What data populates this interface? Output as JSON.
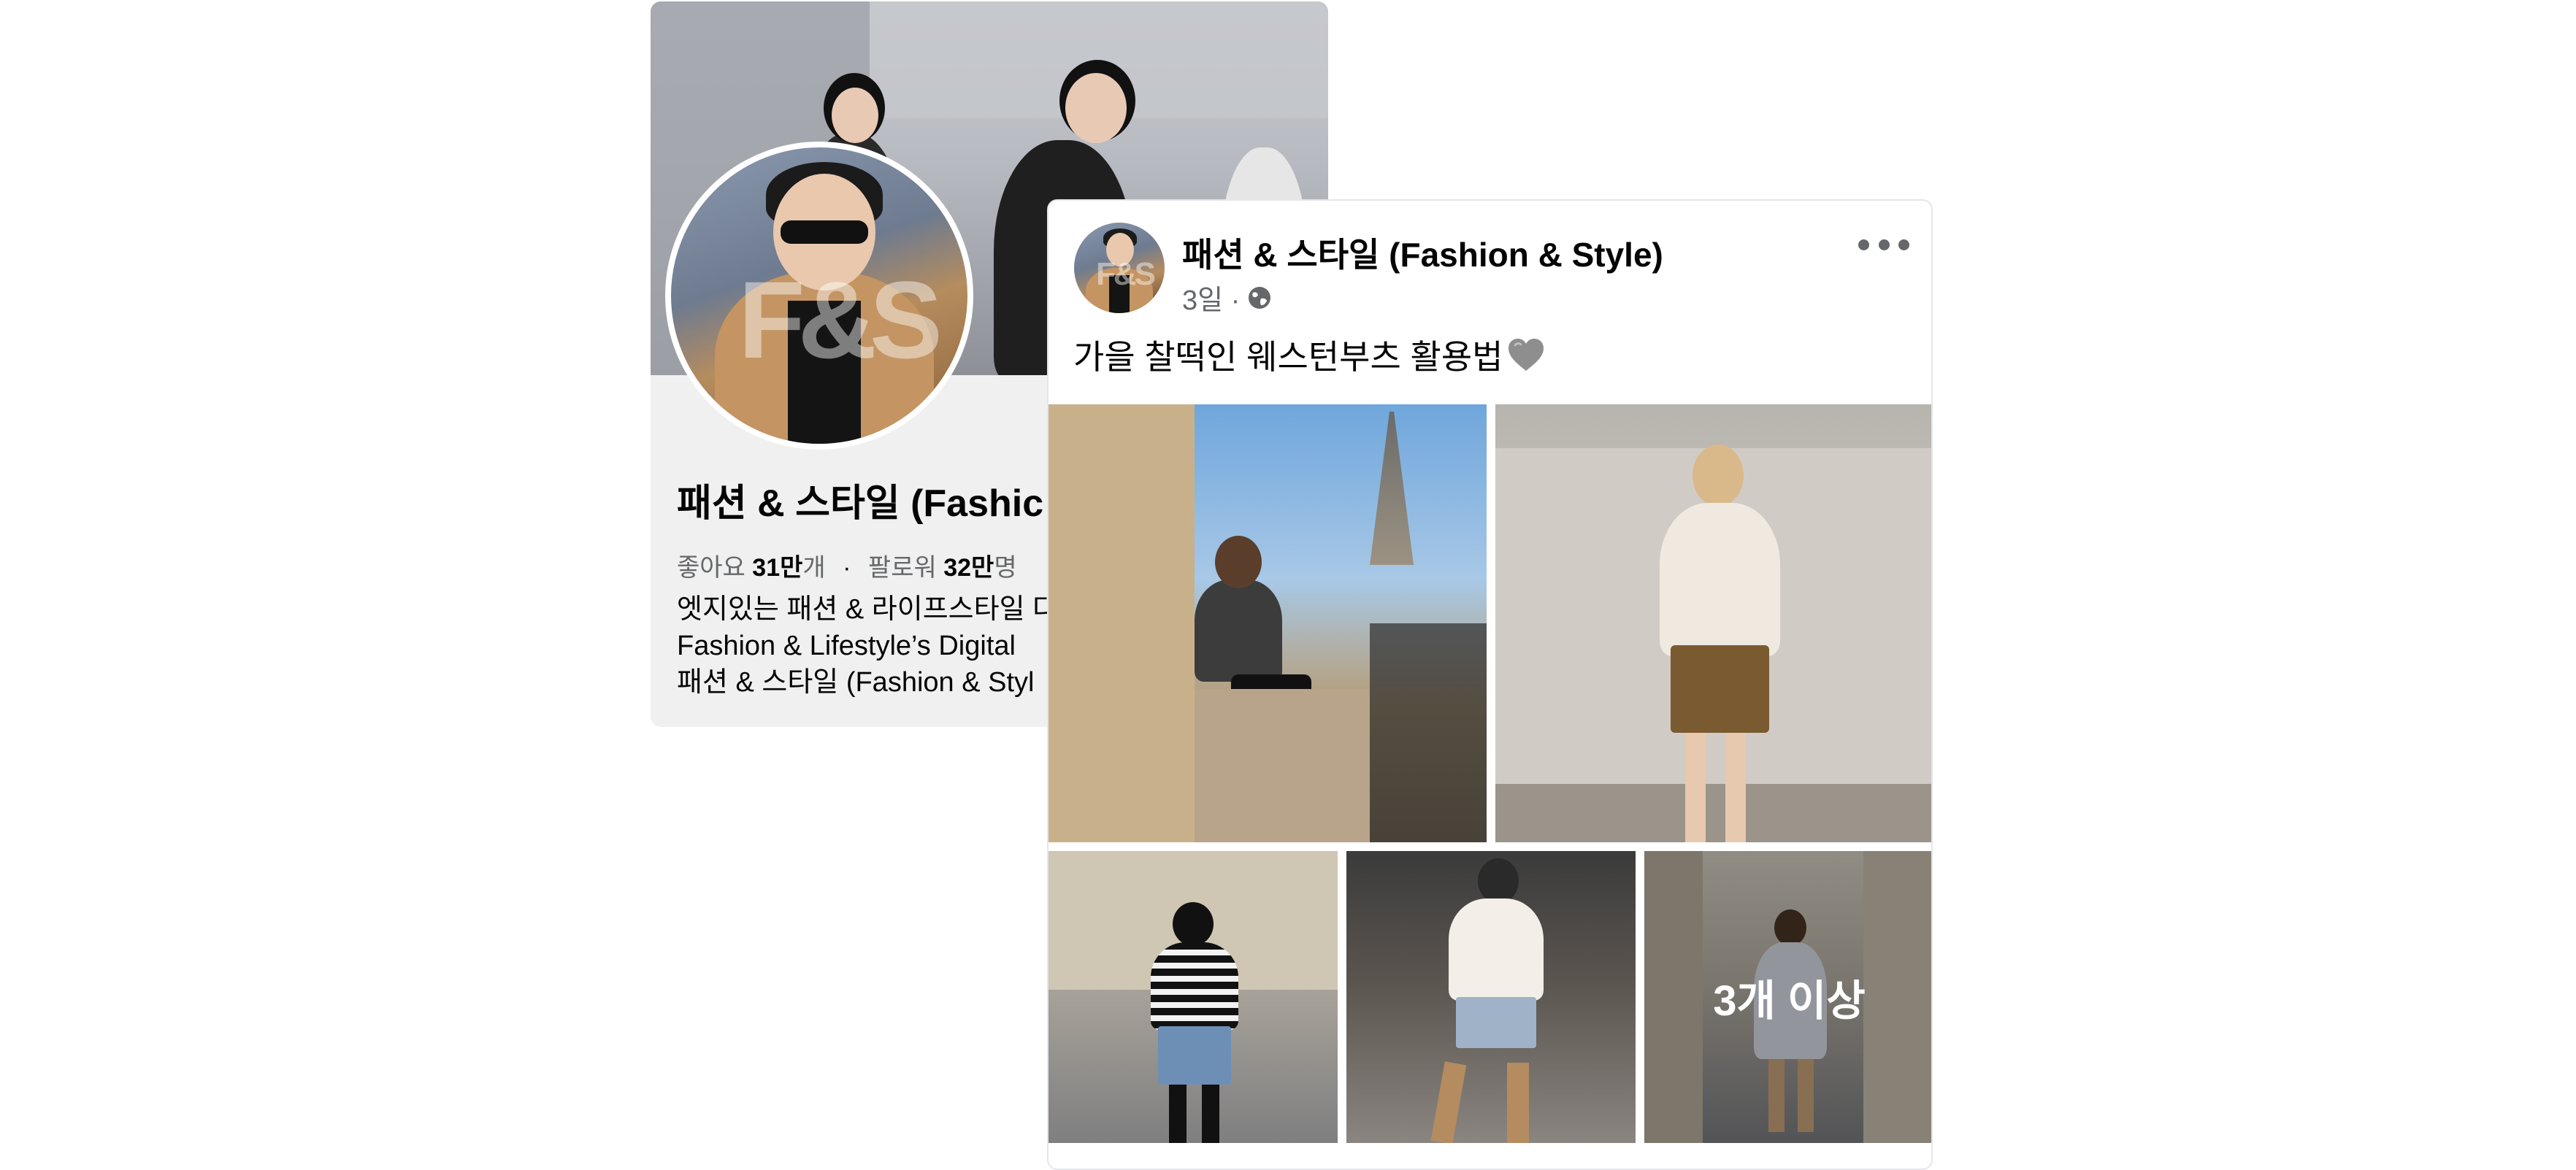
{
  "page_card": {
    "name": "패션 & 스타일 (Fashic",
    "likes_label": "좋아요",
    "likes_value": "31만",
    "likes_unit": "개",
    "separator": "·",
    "followers_label": "팔로워",
    "followers_value": "32만",
    "followers_unit": "명",
    "bio_lines": [
      "엣지있는 패션 & 라이프스타일 다",
      "Fashion & Lifestyle’s Digital",
      "패션 & 스타일 (Fashion & Styl"
    ],
    "avatar_logo": "F&S"
  },
  "post": {
    "author": "패션 & 스타일 (Fashion & Style)",
    "time": "3일 ·",
    "audience_icon": "globe-icon",
    "text": "가을 찰떡인 웨스턴부츠 활용법",
    "emoji_icon": "grey-heart-icon",
    "more_icon": "more-dots-icon",
    "avatar_logo": "F&S",
    "photos": [
      {
        "name": "photo-1"
      },
      {
        "name": "photo-2"
      },
      {
        "name": "photo-3"
      },
      {
        "name": "photo-4"
      },
      {
        "name": "photo-5",
        "overlay": "3개 이상"
      }
    ]
  },
  "colors": {
    "secondary_text": "#65676b",
    "primary_text": "#050505",
    "card_bg": "#f0f0f0"
  }
}
